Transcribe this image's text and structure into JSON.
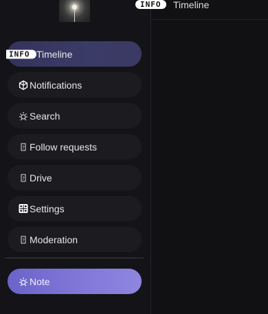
{
  "header": {
    "badge": "INFO",
    "title": "Timeline"
  },
  "sidebar": {
    "items": [
      {
        "label": "Timeline",
        "badge": "INFO",
        "icon": "info-badge",
        "active": true
      },
      {
        "label": "Notifications",
        "icon": "cube-icon"
      },
      {
        "label": "Search",
        "icon": "sun-icon"
      },
      {
        "label": "Follow requests",
        "icon": "unknown-glyph-icon"
      },
      {
        "label": "Drive",
        "icon": "unknown-glyph-icon"
      },
      {
        "label": "Settings",
        "icon": "grid-icon"
      },
      {
        "label": "Moderation",
        "icon": "unknown-glyph-icon"
      }
    ],
    "note_button": {
      "label": "Note",
      "icon": "sun-icon"
    }
  },
  "colors": {
    "accent_start": "#6a63c9",
    "accent_end": "#8f86df",
    "active_item": "#3b3b68",
    "background": "#111114"
  }
}
